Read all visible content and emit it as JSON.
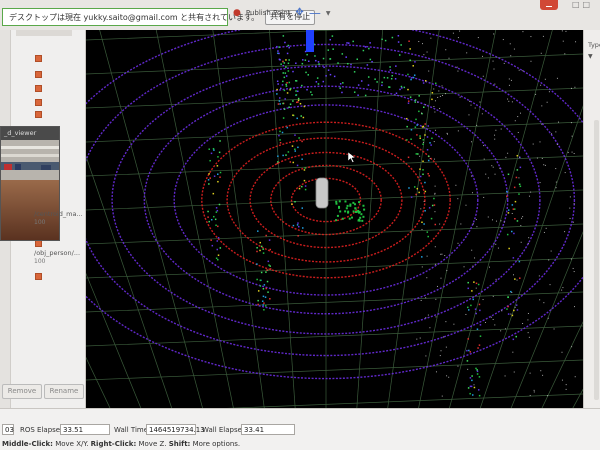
{
  "share_banner": {
    "message": "デスクトップは現在 yukky.saito@gmail.com と共有されています。",
    "stop_label": "共有を停止"
  },
  "toolbar": {
    "publish_point_label": "Publish Point"
  },
  "left_panel": {
    "image_viewer_title": "_d_viewer",
    "items": [
      {
        "label": "/centroid_ma...",
        "value": "100"
      },
      {
        "label": "/obj_person/...",
        "value": "100"
      }
    ],
    "remove_label": "Remove",
    "rename_label": "Rename"
  },
  "right_panel": {
    "label": "Type"
  },
  "time_bar": {
    "ros_time_value": "03",
    "ros_elapsed_label": "ROS Elapsed:",
    "ros_elapsed_value": "33.51",
    "wall_time_label": "Wall Time:",
    "wall_time_value": "1464519734.13",
    "wall_elapsed_label": "Wall Elapsed:",
    "wall_elapsed_value": "33.41"
  },
  "help": {
    "middle_click": "Middle-Click:",
    "middle_click_desc": " Move X/Y. ",
    "right_click": "Right-Click:",
    "right_click_desc": " Move Z. ",
    "shift": "Shift:",
    "shift_desc": " More options."
  },
  "colors": {
    "banner_border": "#5aa84a",
    "rings_near": "#e02020",
    "rings_far": "#6a2ce0",
    "grid": "#3a5a3a",
    "point_green": "#20c040"
  },
  "icons": [
    "pin-icon",
    "crosshair-icon",
    "minus-icon",
    "chevron-down-icon",
    "close-icon"
  ]
}
